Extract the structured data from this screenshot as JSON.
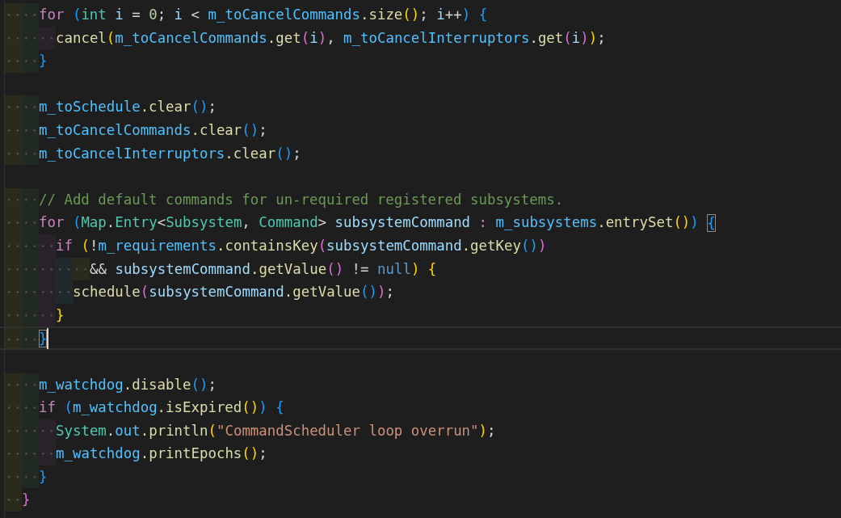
{
  "editor": {
    "lines": [
      {
        "current": false,
        "tokens": [
          {
            "text": "    for ",
            "kind": "control"
          },
          {
            "text": "(",
            "kind": "blue"
          },
          {
            "text": "int",
            "kind": "type"
          },
          {
            "text": " i",
            "kind": "local"
          },
          {
            "text": " = ",
            "kind": "punct"
          },
          {
            "text": "0",
            "kind": "number"
          },
          {
            "text": "; ",
            "kind": "punct"
          },
          {
            "text": "i",
            "kind": "local"
          },
          {
            "text": " < ",
            "kind": "punct"
          },
          {
            "text": "m_toCancelCommands",
            "kind": "field"
          },
          {
            "text": ".size",
            "kind": "method"
          },
          {
            "text": "()",
            "kind": "gold"
          },
          {
            "text": "; ",
            "kind": "punct"
          },
          {
            "text": "i",
            "kind": "local"
          },
          {
            "text": "++",
            "kind": "punct"
          },
          {
            "text": ") {",
            "kind": "blue"
          }
        ]
      },
      {
        "current": false,
        "tokens": [
          {
            "text": "      cancel",
            "kind": "method"
          },
          {
            "text": "(",
            "kind": "gold"
          },
          {
            "text": "m_toCancelCommands",
            "kind": "field"
          },
          {
            "text": ".get",
            "kind": "method"
          },
          {
            "text": "(",
            "kind": "orchid"
          },
          {
            "text": "i",
            "kind": "local"
          },
          {
            "text": ")",
            "kind": "orchid"
          },
          {
            "text": ", ",
            "kind": "punct"
          },
          {
            "text": "m_toCancelInterruptors",
            "kind": "field"
          },
          {
            "text": ".get",
            "kind": "method"
          },
          {
            "text": "(",
            "kind": "orchid"
          },
          {
            "text": "i",
            "kind": "local"
          },
          {
            "text": ")",
            "kind": "orchid"
          },
          {
            "text": ")",
            "kind": "gold"
          },
          {
            "text": ";",
            "kind": "punct"
          }
        ]
      },
      {
        "current": false,
        "tokens": [
          {
            "text": "    }",
            "kind": "blue"
          }
        ]
      },
      {
        "kind": "blank"
      },
      {
        "current": false,
        "tokens": [
          {
            "text": "    m_toSchedule",
            "kind": "field"
          },
          {
            "text": ".clear",
            "kind": "method"
          },
          {
            "text": "()",
            "kind": "blue"
          },
          {
            "text": ";",
            "kind": "punct"
          }
        ]
      },
      {
        "current": false,
        "tokens": [
          {
            "text": "    m_toCancelCommands",
            "kind": "field"
          },
          {
            "text": ".clear",
            "kind": "method"
          },
          {
            "text": "()",
            "kind": "blue"
          },
          {
            "text": ";",
            "kind": "punct"
          }
        ]
      },
      {
        "current": false,
        "tokens": [
          {
            "text": "    m_toCancelInterruptors",
            "kind": "field"
          },
          {
            "text": ".clear",
            "kind": "method"
          },
          {
            "text": "()",
            "kind": "blue"
          },
          {
            "text": ";",
            "kind": "punct"
          }
        ]
      },
      {
        "kind": "blank"
      },
      {
        "current": false,
        "tokens": [
          {
            "text": "    // Add default commands for un-required registered subsystems.",
            "kind": "comment"
          }
        ]
      },
      {
        "current": false,
        "tokens": [
          {
            "text": "    for ",
            "kind": "control"
          },
          {
            "text": "(",
            "kind": "blue"
          },
          {
            "text": "Map",
            "kind": "type"
          },
          {
            "text": ".",
            "kind": "punct"
          },
          {
            "text": "Entry",
            "kind": "type"
          },
          {
            "text": "<",
            "kind": "punct"
          },
          {
            "text": "Subsystem",
            "kind": "type"
          },
          {
            "text": ", ",
            "kind": "punct"
          },
          {
            "text": "Command",
            "kind": "type"
          },
          {
            "text": "> ",
            "kind": "punct"
          },
          {
            "text": "subsystemCommand",
            "kind": "local"
          },
          {
            "text": " : ",
            "kind": "control"
          },
          {
            "text": "m_subsystems",
            "kind": "field"
          },
          {
            "text": ".entrySet",
            "kind": "method"
          },
          {
            "text": "()",
            "kind": "gold"
          },
          {
            "text": ") ",
            "kind": "blue"
          },
          {
            "text": "{",
            "kind": "blue",
            "matched": true
          }
        ]
      },
      {
        "current": false,
        "tokens": [
          {
            "text": "      if ",
            "kind": "control"
          },
          {
            "text": "(",
            "kind": "gold"
          },
          {
            "text": "!",
            "kind": "punct"
          },
          {
            "text": "m_requirements",
            "kind": "field"
          },
          {
            "text": ".containsKey",
            "kind": "method"
          },
          {
            "text": "(",
            "kind": "orchid"
          },
          {
            "text": "subsystemCommand",
            "kind": "local"
          },
          {
            "text": ".getKey",
            "kind": "method"
          },
          {
            "text": "()",
            "kind": "blue"
          },
          {
            "text": ")",
            "kind": "orchid"
          }
        ]
      },
      {
        "current": false,
        "tokens": [
          {
            "text": "          && ",
            "kind": "punct"
          },
          {
            "text": "subsystemCommand",
            "kind": "local"
          },
          {
            "text": ".getValue",
            "kind": "method"
          },
          {
            "text": "()",
            "kind": "orchid"
          },
          {
            "text": " != ",
            "kind": "punct"
          },
          {
            "text": "null",
            "kind": "keyword"
          },
          {
            "text": ") {",
            "kind": "gold"
          }
        ]
      },
      {
        "current": false,
        "tokens": [
          {
            "text": "        schedule",
            "kind": "method"
          },
          {
            "text": "(",
            "kind": "orchid"
          },
          {
            "text": "subsystemCommand",
            "kind": "local"
          },
          {
            "text": ".getValue",
            "kind": "method"
          },
          {
            "text": "()",
            "kind": "blue"
          },
          {
            "text": ")",
            "kind": "orchid"
          },
          {
            "text": ";",
            "kind": "punct"
          }
        ]
      },
      {
        "current": false,
        "tokens": [
          {
            "text": "      }",
            "kind": "gold"
          }
        ]
      },
      {
        "current": true,
        "tokens": [
          {
            "text": "    }",
            "kind": "blue",
            "matched": true
          }
        ]
      },
      {
        "kind": "blank"
      },
      {
        "current": false,
        "tokens": [
          {
            "text": "    m_watchdog",
            "kind": "field"
          },
          {
            "text": ".disable",
            "kind": "method"
          },
          {
            "text": "()",
            "kind": "blue"
          },
          {
            "text": ";",
            "kind": "punct"
          }
        ]
      },
      {
        "current": false,
        "tokens": [
          {
            "text": "    if ",
            "kind": "control"
          },
          {
            "text": "(",
            "kind": "blue"
          },
          {
            "text": "m_watchdog",
            "kind": "field"
          },
          {
            "text": ".isExpired",
            "kind": "method"
          },
          {
            "text": "()",
            "kind": "gold"
          },
          {
            "text": ") {",
            "kind": "blue"
          }
        ]
      },
      {
        "current": false,
        "tokens": [
          {
            "text": "      System",
            "kind": "type"
          },
          {
            "text": ".",
            "kind": "punct"
          },
          {
            "text": "out",
            "kind": "field"
          },
          {
            "text": ".println",
            "kind": "method"
          },
          {
            "text": "(",
            "kind": "gold"
          },
          {
            "text": "\"CommandScheduler loop overrun\"",
            "kind": "string"
          },
          {
            "text": ")",
            "kind": "gold"
          },
          {
            "text": ";",
            "kind": "punct"
          }
        ]
      },
      {
        "current": false,
        "tokens": [
          {
            "text": "      m_watchdog",
            "kind": "field"
          },
          {
            "text": ".printEpochs",
            "kind": "method"
          },
          {
            "text": "()",
            "kind": "gold"
          },
          {
            "text": ";",
            "kind": "punct"
          }
        ]
      },
      {
        "current": false,
        "tokens": [
          {
            "text": "    }",
            "kind": "blue"
          }
        ]
      },
      {
        "current": false,
        "tokens": [
          {
            "text": "  }",
            "kind": "orchid"
          }
        ]
      }
    ]
  }
}
